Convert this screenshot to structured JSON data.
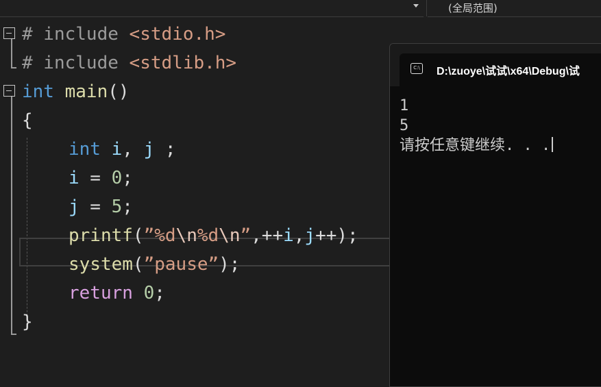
{
  "scope_bar": {
    "scope": "(全局范围)"
  },
  "code": {
    "line1": {
      "directive": "# include",
      "header": "<stdio.h>"
    },
    "line2": {
      "directive": "# include",
      "header": "<stdlib.h>"
    },
    "line3": {
      "type": "int",
      "name": "main",
      "parens": "()"
    },
    "line4": {
      "brace": "{"
    },
    "line5": {
      "type": "int",
      "i": "i",
      "comma": ",",
      "j": "j",
      "semi": ";"
    },
    "line6": {
      "var": "i",
      "op": " = ",
      "num": "0",
      "semi": ";"
    },
    "line7": {
      "var": "j",
      "op": " = ",
      "num": "5",
      "semi": ";"
    },
    "line8": {
      "fn": "printf",
      "open": "(",
      "s1": "”%d",
      "e1": "\\n",
      "s2": "%d",
      "e2": "\\n",
      "s3": "”",
      "comma1": ",",
      "pre": "++",
      "i": "i",
      "comma2": ",",
      "j": "j",
      "post": "++",
      "close": ");"
    },
    "line9": {
      "fn": "system",
      "open": "(",
      "str": "”pause”",
      "close": ");"
    },
    "line10": {
      "kw": "return",
      "num": "0",
      "semi": ";"
    },
    "line11": {
      "brace": "}"
    }
  },
  "console": {
    "title": "D:\\zuoye\\试试\\x64\\Debug\\试",
    "icon_text": "C:\\",
    "output": [
      "1",
      "5",
      "请按任意键继续. . ."
    ]
  }
}
